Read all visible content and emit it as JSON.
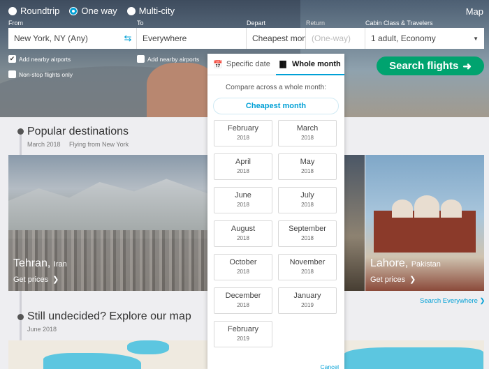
{
  "trip_types": [
    {
      "label": "Roundtrip",
      "selected": false
    },
    {
      "label": "One way",
      "selected": true
    },
    {
      "label": "Multi-city",
      "selected": false
    }
  ],
  "map_link": "Map",
  "labels": {
    "from": "From",
    "to": "To",
    "depart": "Depart",
    "return": "Return",
    "cabin": "Cabin Class & Travelers"
  },
  "fields": {
    "from_value": "New York, NY (Any)",
    "to_value": "Everywhere",
    "depart_value": "Cheapest mont",
    "return_value": "(One-way)",
    "cabin_value": "1 adult, Economy"
  },
  "checkboxes": {
    "nearby_from": {
      "label": "Add nearby airports",
      "checked": true
    },
    "nearby_to": {
      "label": "Add nearby airports",
      "checked": false
    },
    "nonstop": {
      "label": "Non-stop flights only",
      "checked": false
    }
  },
  "search_button": "Search flights",
  "popular": {
    "title": "Popular destinations",
    "date": "March 2018",
    "flying_from": "Flying from New York"
  },
  "cards": {
    "tehran": {
      "city": "Tehran,",
      "country": "Iran",
      "link": "Get prices"
    },
    "lahore": {
      "city": "Lahore,",
      "country": "Pakistan",
      "link": "Get prices"
    }
  },
  "search_everywhere": "Search Everywhere",
  "explore": {
    "title": "Still undecided? Explore our map",
    "date": "June 2018"
  },
  "dropdown": {
    "tab_specific": "Specific date",
    "tab_month": "Whole month",
    "compare_text": "Compare across a whole month:",
    "cheapest_button": "Cheapest month",
    "months": [
      {
        "month": "February",
        "year": "2018"
      },
      {
        "month": "March",
        "year": "2018"
      },
      {
        "month": "April",
        "year": "2018"
      },
      {
        "month": "May",
        "year": "2018"
      },
      {
        "month": "June",
        "year": "2018"
      },
      {
        "month": "July",
        "year": "2018"
      },
      {
        "month": "August",
        "year": "2018"
      },
      {
        "month": "September",
        "year": "2018"
      },
      {
        "month": "October",
        "year": "2018"
      },
      {
        "month": "November",
        "year": "2018"
      },
      {
        "month": "December",
        "year": "2018"
      },
      {
        "month": "January",
        "year": "2019"
      },
      {
        "month": "February",
        "year": "2019"
      }
    ],
    "cancel": "Cancel"
  },
  "colors": {
    "accent": "#00a0d6",
    "search_button": "#00a36f"
  }
}
